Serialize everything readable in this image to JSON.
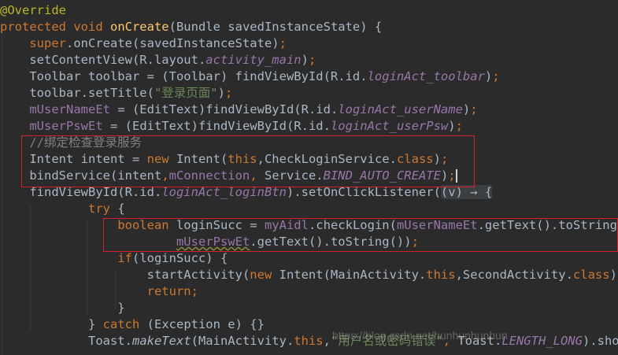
{
  "editor": {
    "lines": [
      [
        {
          "t": "@Override",
          "c": "ann"
        }
      ],
      [
        {
          "t": "protected void ",
          "c": "kw"
        },
        {
          "t": "onCreate",
          "c": "fn"
        },
        {
          "t": "(Bundle savedInstanceState) {"
        }
      ],
      [
        {
          "t": "    "
        },
        {
          "t": "super",
          "c": "kw"
        },
        {
          "t": ".onCreate(savedInstanceState)"
        },
        {
          "t": ";",
          "c": "kw"
        }
      ],
      [
        {
          "t": "    setContentView(R.layout."
        },
        {
          "t": "activity_main",
          "c": "ifld"
        },
        {
          "t": ")"
        },
        {
          "t": ";",
          "c": "kw"
        }
      ],
      [
        {
          "t": "    Toolbar toolbar = (Toolbar) findViewById(R.id."
        },
        {
          "t": "loginAct_toolbar",
          "c": "ifld"
        },
        {
          "t": ")"
        },
        {
          "t": ";",
          "c": "kw"
        }
      ],
      [
        {
          "t": "    toolbar.setTitle("
        },
        {
          "t": "\"登录页面\"",
          "c": "str"
        },
        {
          "t": ")"
        },
        {
          "t": ";",
          "c": "kw"
        }
      ],
      [
        {
          "t": "    "
        },
        {
          "t": "mUserNameEt",
          "c": "fld"
        },
        {
          "t": " = (EditText)findViewById(R.id."
        },
        {
          "t": "loginAct_userName",
          "c": "ifld"
        },
        {
          "t": ")"
        },
        {
          "t": ";",
          "c": "kw"
        }
      ],
      [
        {
          "t": "    "
        },
        {
          "t": "mUserPswEt",
          "c": "fld"
        },
        {
          "t": " = (EditText)findViewById(R.id."
        },
        {
          "t": "loginAct_userPsw",
          "c": "ifld"
        },
        {
          "t": ")"
        },
        {
          "t": ";",
          "c": "kw"
        }
      ],
      [
        {
          "t": "    //绑定检查登录服务",
          "c": "cmt"
        }
      ],
      [
        {
          "t": "    Intent intent = "
        },
        {
          "t": "new ",
          "c": "kw"
        },
        {
          "t": "Intent("
        },
        {
          "t": "this",
          "c": "kw"
        },
        {
          "t": ","
        },
        {
          "t": "CheckLoginService."
        },
        {
          "t": "class",
          "c": "kw"
        },
        {
          "t": ")"
        },
        {
          "t": ";",
          "c": "kw"
        }
      ],
      [
        {
          "t": "    bindService(intent"
        },
        {
          "t": ",",
          "c": "kw"
        },
        {
          "t": "mConnection",
          "c": "fld"
        },
        {
          "t": ", ",
          "c": "kw"
        },
        {
          "t": "Service."
        },
        {
          "t": "BIND_AUTO_CREATE",
          "c": "ifld"
        },
        {
          "t": ")"
        },
        {
          "t": ";",
          "c": "kw"
        },
        {
          "caret": true
        }
      ],
      [
        {
          "t": "    findViewById(R.id."
        },
        {
          "t": "loginAct_loginBtn",
          "c": "ifld"
        },
        {
          "t": ").setOnClickListener("
        },
        {
          "t": "(v) → {",
          "c": "fold"
        }
      ],
      [
        {
          "t": "            "
        },
        {
          "t": "try ",
          "c": "kw"
        },
        {
          "t": "{"
        }
      ],
      [
        {
          "t": "                "
        },
        {
          "t": "boolean ",
          "c": "kw"
        },
        {
          "t": "loginSucc = "
        },
        {
          "t": "myAidl",
          "c": "fld"
        },
        {
          "t": ".checkLogin("
        },
        {
          "t": "mUserNameEt",
          "c": "fld"
        },
        {
          "t": ".getText().toString()"
        },
        {
          "t": ",",
          "c": "kw"
        }
      ],
      [
        {
          "t": "                        "
        },
        {
          "t": "mUserPswEt",
          "c": "fld",
          "w": true
        },
        {
          "t": ".getText().toString())"
        },
        {
          "t": ";",
          "c": "kw"
        }
      ],
      [
        {
          "t": "                "
        },
        {
          "t": "if",
          "c": "kw"
        },
        {
          "t": "(loginSucc) {"
        }
      ],
      [
        {
          "t": "                    startActivity("
        },
        {
          "t": "new ",
          "c": "kw"
        },
        {
          "t": "Intent(MainActivity."
        },
        {
          "t": "this",
          "c": "kw"
        },
        {
          "t": ","
        },
        {
          "t": "SecondActivity."
        },
        {
          "t": "class",
          "c": "kw"
        },
        {
          "t": "))"
        },
        {
          "t": ";",
          "c": "kw"
        }
      ],
      [
        {
          "t": "                    "
        },
        {
          "t": "return",
          "c": "kw"
        },
        {
          "t": ";",
          "c": "kw"
        }
      ],
      [
        {
          "t": "                }"
        }
      ],
      [
        {
          "t": "            } "
        },
        {
          "t": "catch ",
          "c": "kw"
        },
        {
          "t": "(Exception e) {}"
        }
      ],
      [
        {
          "t": "            Toast."
        },
        {
          "t": "makeText",
          "c": "sm"
        },
        {
          "t": "(MainActivity."
        },
        {
          "t": "this",
          "c": "kw"
        },
        {
          "t": ","
        },
        {
          "t": "\"用户名或密码错误\"",
          "c": "str"
        },
        {
          "t": ", ",
          "c": "kw"
        },
        {
          "t": "Toast."
        },
        {
          "t": "LENGTH_LONG",
          "c": "ifld"
        },
        {
          "t": ").show("
        }
      ]
    ]
  },
  "watermark": {
    "text": "https://blog.csdn.net/hunhunhunhun"
  }
}
